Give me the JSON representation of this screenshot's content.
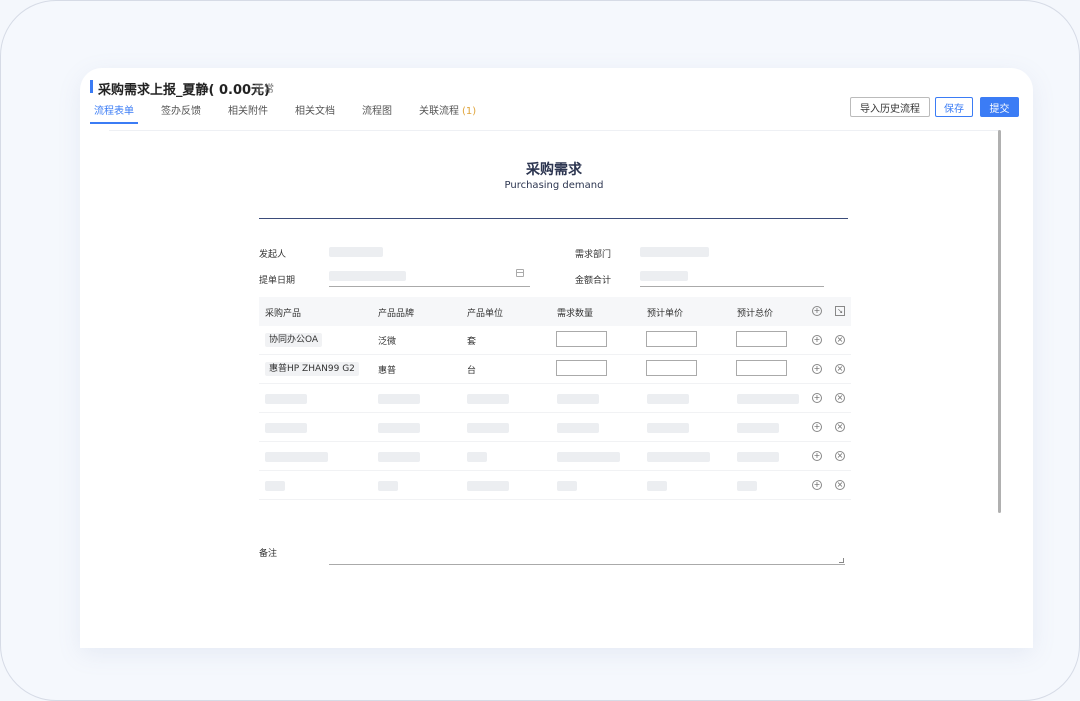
{
  "header": {
    "title": "采购需求上报_夏静( 0.00元)",
    "status": "正常",
    "tabs": [
      {
        "label": "流程表单",
        "active": true
      },
      {
        "label": "签办反馈"
      },
      {
        "label": "相关附件"
      },
      {
        "label": "相关文档"
      },
      {
        "label": "流程图"
      },
      {
        "label": "关联流程",
        "count": "(1)"
      }
    ],
    "buttons": {
      "history": "导入历史流程",
      "save": "保存",
      "submit": "提交"
    },
    "accent_color": "#3b7cf5"
  },
  "form": {
    "title": "采购需求",
    "subtitle": "Purchasing demand",
    "fields": {
      "initiator": "发起人",
      "department": "需求部门",
      "date": "提单日期",
      "total": "金额合计",
      "remarks": "备注"
    },
    "table": {
      "columns": [
        "采购产品",
        "产品品牌",
        "产品单位",
        "需求数量",
        "预计单价",
        "预计总价"
      ],
      "rows": [
        {
          "product": "协同办公OA",
          "brand": "泛微",
          "unit": "套"
        },
        {
          "product": "惠普HP ZHAN99 G2",
          "brand": "惠普",
          "unit": "台"
        }
      ]
    }
  }
}
